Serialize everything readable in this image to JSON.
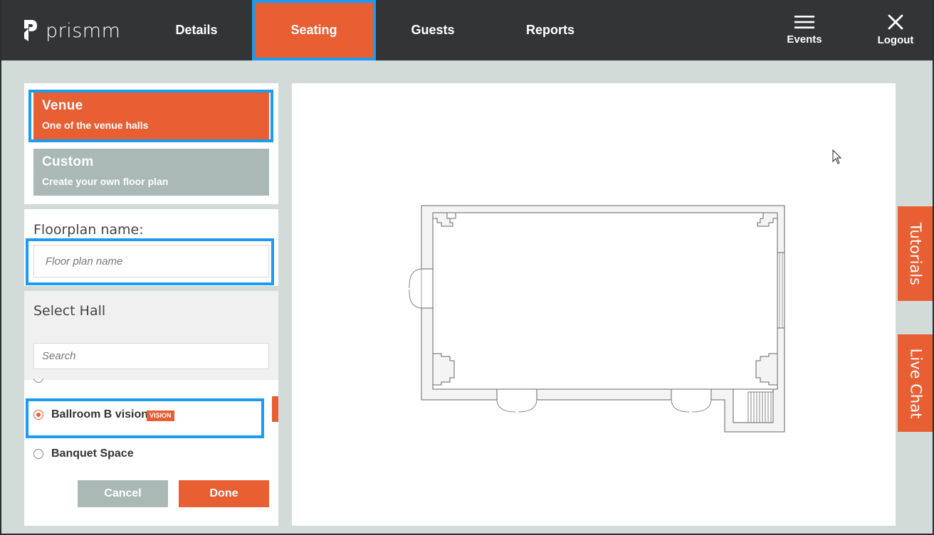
{
  "brand": {
    "name": "prismm"
  },
  "nav": {
    "tabs": [
      {
        "label": "Details"
      },
      {
        "label": "Seating"
      },
      {
        "label": "Guests"
      },
      {
        "label": "Reports"
      }
    ],
    "events_label": "Events",
    "logout_label": "Logout"
  },
  "floorplan_type": {
    "venue": {
      "title": "Venue",
      "subtitle": "One of the venue halls"
    },
    "custom": {
      "title": "Custom",
      "subtitle": "Create your own floor plan"
    }
  },
  "floorplan_name": {
    "label": "Floorplan name:",
    "placeholder": "Floor plan name",
    "value": ""
  },
  "select_hall": {
    "title": "Select Hall",
    "search_placeholder": "Search",
    "halls": [
      {
        "label": "Ballroom B vision",
        "badge": "VISION",
        "selected": true
      },
      {
        "label": "Banquet Space",
        "selected": false
      }
    ]
  },
  "actions": {
    "cancel_label": "Cancel",
    "done_label": "Done"
  },
  "side_tabs": {
    "tutorials_label": "Tutorials",
    "live_chat_label": "Live Chat"
  },
  "colors": {
    "accent": "#e85f34",
    "nav_bg": "#323436",
    "muted": "#aab9b6",
    "highlight": "#1c9bf0"
  }
}
